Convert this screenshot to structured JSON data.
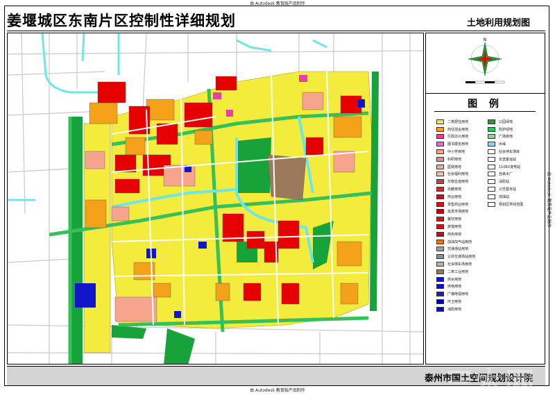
{
  "watermark_text": "由 Autodesk 教育版产品制作",
  "title": "姜堰城区东南片区控制性详细规划",
  "subtitle": "土地利用规划图",
  "legend_title": "图 例",
  "organization": "泰州市国土空间规划设计院",
  "site_watermark": "三木网",
  "legend_left": [
    {
      "label": "二类居住用地",
      "color": "#f3ec3c"
    },
    {
      "label": "商住混合用地",
      "color": "#f3a21a"
    },
    {
      "label": "行政办公用地",
      "color": "#e940a0"
    },
    {
      "label": "图书展览用地",
      "color": "#e070c0"
    },
    {
      "label": "中小学用地",
      "color": "#f7a48e"
    },
    {
      "label": "科研用地",
      "color": "#f08a8a"
    },
    {
      "label": "医院用地",
      "color": "#e8b0a0"
    },
    {
      "label": "社会福利用地",
      "color": "#f0c0b0"
    },
    {
      "label": "文物古迹用地",
      "color": "#c84040"
    },
    {
      "label": "宗教用地",
      "color": "#b03a2a"
    },
    {
      "label": "商业用地",
      "color": "#e60000"
    },
    {
      "label": "零售商业用地",
      "color": "#d41414"
    },
    {
      "label": "批发市场用地",
      "color": "#c40000"
    },
    {
      "label": "餐饮用地",
      "color": "#e80c0c"
    },
    {
      "label": "旅馆用地",
      "color": "#dc1010"
    },
    {
      "label": "商务用地",
      "color": "#d00808"
    },
    {
      "label": "加油加气站用地",
      "color": "#e07820"
    },
    {
      "label": "交通场站用地",
      "color": "#a0a0a0"
    },
    {
      "label": "公共交通场站用地",
      "color": "#909090"
    },
    {
      "label": "社会停车场用地",
      "color": "#b4b4b4"
    },
    {
      "label": "二类工业用地",
      "color": "#9a7a5a"
    },
    {
      "label": "供水用地",
      "color": "#0e16c8"
    },
    {
      "label": "供电用地",
      "color": "#1010c0"
    },
    {
      "label": "广播电视用地",
      "color": "#2020b0"
    },
    {
      "label": "环卫用地",
      "color": "#0000a0"
    },
    {
      "label": "消防用地",
      "color": "#0010d0"
    }
  ],
  "legend_right": [
    {
      "label": "公园绿地",
      "color": "#17a33a"
    },
    {
      "label": "防护绿地",
      "color": "#35c05a"
    },
    {
      "label": "广场用地",
      "color": "#8fd39f"
    },
    {
      "label": "水域",
      "color": "#6fe6e6"
    },
    {
      "label": "社会停车场库",
      "color": "#ffffff"
    },
    {
      "label": "长途客运站",
      "color": "#ffffff"
    },
    {
      "label": "110KV变电站",
      "color": "#ffffff"
    },
    {
      "label": "自来水厂",
      "color": "#ffffff"
    },
    {
      "label": "消防站",
      "color": "#ffffff"
    },
    {
      "label": "公交首末站",
      "color": "#ffffff"
    },
    {
      "label": "加油站",
      "color": "#ffffff"
    },
    {
      "label": "规划区界线范围",
      "color": "#ffffff"
    }
  ],
  "colors": {
    "residential": "#f3ec3c",
    "mixed": "#f3a21a",
    "commercial": "#e60000",
    "school": "#f7a48e",
    "green": "#17a33a",
    "buffer_green": "#35c05a",
    "water": "#6fe6e6",
    "industrial": "#9a7a5a",
    "utility": "#0e16c8",
    "road": "#ffffff",
    "footer": "#d4d4d4"
  }
}
